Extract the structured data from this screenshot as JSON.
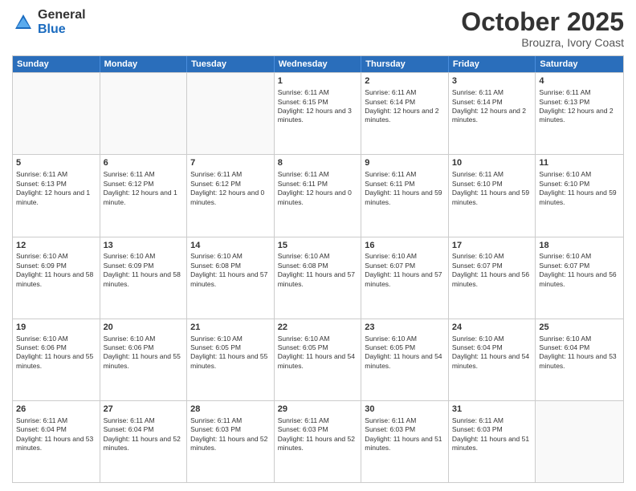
{
  "logo": {
    "general": "General",
    "blue": "Blue"
  },
  "header": {
    "month": "October 2025",
    "location": "Brouzra, Ivory Coast"
  },
  "weekdays": [
    "Sunday",
    "Monday",
    "Tuesday",
    "Wednesday",
    "Thursday",
    "Friday",
    "Saturday"
  ],
  "rows": [
    [
      {
        "day": "",
        "empty": true
      },
      {
        "day": "",
        "empty": true
      },
      {
        "day": "",
        "empty": true
      },
      {
        "day": "1",
        "sunrise": "Sunrise: 6:11 AM",
        "sunset": "Sunset: 6:15 PM",
        "daylight": "Daylight: 12 hours and 3 minutes."
      },
      {
        "day": "2",
        "sunrise": "Sunrise: 6:11 AM",
        "sunset": "Sunset: 6:14 PM",
        "daylight": "Daylight: 12 hours and 2 minutes."
      },
      {
        "day": "3",
        "sunrise": "Sunrise: 6:11 AM",
        "sunset": "Sunset: 6:14 PM",
        "daylight": "Daylight: 12 hours and 2 minutes."
      },
      {
        "day": "4",
        "sunrise": "Sunrise: 6:11 AM",
        "sunset": "Sunset: 6:13 PM",
        "daylight": "Daylight: 12 hours and 2 minutes."
      }
    ],
    [
      {
        "day": "5",
        "sunrise": "Sunrise: 6:11 AM",
        "sunset": "Sunset: 6:13 PM",
        "daylight": "Daylight: 12 hours and 1 minute."
      },
      {
        "day": "6",
        "sunrise": "Sunrise: 6:11 AM",
        "sunset": "Sunset: 6:12 PM",
        "daylight": "Daylight: 12 hours and 1 minute."
      },
      {
        "day": "7",
        "sunrise": "Sunrise: 6:11 AM",
        "sunset": "Sunset: 6:12 PM",
        "daylight": "Daylight: 12 hours and 0 minutes."
      },
      {
        "day": "8",
        "sunrise": "Sunrise: 6:11 AM",
        "sunset": "Sunset: 6:11 PM",
        "daylight": "Daylight: 12 hours and 0 minutes."
      },
      {
        "day": "9",
        "sunrise": "Sunrise: 6:11 AM",
        "sunset": "Sunset: 6:11 PM",
        "daylight": "Daylight: 11 hours and 59 minutes."
      },
      {
        "day": "10",
        "sunrise": "Sunrise: 6:11 AM",
        "sunset": "Sunset: 6:10 PM",
        "daylight": "Daylight: 11 hours and 59 minutes."
      },
      {
        "day": "11",
        "sunrise": "Sunrise: 6:10 AM",
        "sunset": "Sunset: 6:10 PM",
        "daylight": "Daylight: 11 hours and 59 minutes."
      }
    ],
    [
      {
        "day": "12",
        "sunrise": "Sunrise: 6:10 AM",
        "sunset": "Sunset: 6:09 PM",
        "daylight": "Daylight: 11 hours and 58 minutes."
      },
      {
        "day": "13",
        "sunrise": "Sunrise: 6:10 AM",
        "sunset": "Sunset: 6:09 PM",
        "daylight": "Daylight: 11 hours and 58 minutes."
      },
      {
        "day": "14",
        "sunrise": "Sunrise: 6:10 AM",
        "sunset": "Sunset: 6:08 PM",
        "daylight": "Daylight: 11 hours and 57 minutes."
      },
      {
        "day": "15",
        "sunrise": "Sunrise: 6:10 AM",
        "sunset": "Sunset: 6:08 PM",
        "daylight": "Daylight: 11 hours and 57 minutes."
      },
      {
        "day": "16",
        "sunrise": "Sunrise: 6:10 AM",
        "sunset": "Sunset: 6:07 PM",
        "daylight": "Daylight: 11 hours and 57 minutes."
      },
      {
        "day": "17",
        "sunrise": "Sunrise: 6:10 AM",
        "sunset": "Sunset: 6:07 PM",
        "daylight": "Daylight: 11 hours and 56 minutes."
      },
      {
        "day": "18",
        "sunrise": "Sunrise: 6:10 AM",
        "sunset": "Sunset: 6:07 PM",
        "daylight": "Daylight: 11 hours and 56 minutes."
      }
    ],
    [
      {
        "day": "19",
        "sunrise": "Sunrise: 6:10 AM",
        "sunset": "Sunset: 6:06 PM",
        "daylight": "Daylight: 11 hours and 55 minutes."
      },
      {
        "day": "20",
        "sunrise": "Sunrise: 6:10 AM",
        "sunset": "Sunset: 6:06 PM",
        "daylight": "Daylight: 11 hours and 55 minutes."
      },
      {
        "day": "21",
        "sunrise": "Sunrise: 6:10 AM",
        "sunset": "Sunset: 6:05 PM",
        "daylight": "Daylight: 11 hours and 55 minutes."
      },
      {
        "day": "22",
        "sunrise": "Sunrise: 6:10 AM",
        "sunset": "Sunset: 6:05 PM",
        "daylight": "Daylight: 11 hours and 54 minutes."
      },
      {
        "day": "23",
        "sunrise": "Sunrise: 6:10 AM",
        "sunset": "Sunset: 6:05 PM",
        "daylight": "Daylight: 11 hours and 54 minutes."
      },
      {
        "day": "24",
        "sunrise": "Sunrise: 6:10 AM",
        "sunset": "Sunset: 6:04 PM",
        "daylight": "Daylight: 11 hours and 54 minutes."
      },
      {
        "day": "25",
        "sunrise": "Sunrise: 6:10 AM",
        "sunset": "Sunset: 6:04 PM",
        "daylight": "Daylight: 11 hours and 53 minutes."
      }
    ],
    [
      {
        "day": "26",
        "sunrise": "Sunrise: 6:11 AM",
        "sunset": "Sunset: 6:04 PM",
        "daylight": "Daylight: 11 hours and 53 minutes."
      },
      {
        "day": "27",
        "sunrise": "Sunrise: 6:11 AM",
        "sunset": "Sunset: 6:04 PM",
        "daylight": "Daylight: 11 hours and 52 minutes."
      },
      {
        "day": "28",
        "sunrise": "Sunrise: 6:11 AM",
        "sunset": "Sunset: 6:03 PM",
        "daylight": "Daylight: 11 hours and 52 minutes."
      },
      {
        "day": "29",
        "sunrise": "Sunrise: 6:11 AM",
        "sunset": "Sunset: 6:03 PM",
        "daylight": "Daylight: 11 hours and 52 minutes."
      },
      {
        "day": "30",
        "sunrise": "Sunrise: 6:11 AM",
        "sunset": "Sunset: 6:03 PM",
        "daylight": "Daylight: 11 hours and 51 minutes."
      },
      {
        "day": "31",
        "sunrise": "Sunrise: 6:11 AM",
        "sunset": "Sunset: 6:03 PM",
        "daylight": "Daylight: 11 hours and 51 minutes."
      },
      {
        "day": "",
        "empty": true
      }
    ]
  ]
}
